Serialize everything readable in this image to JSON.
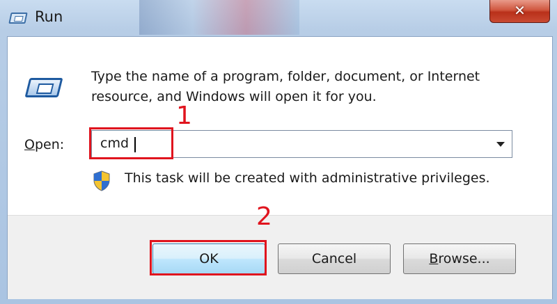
{
  "window": {
    "title": "Run",
    "close_label": "✕"
  },
  "dialog": {
    "description": "Type the name of a program, folder, document, or Internet resource, and Windows will open it for you.",
    "open_label_accel": "O",
    "open_label_rest": "pen:",
    "open_value": "cmd",
    "admin_notice": "This task will be created with administrative privileges."
  },
  "buttons": {
    "ok": "OK",
    "cancel": "Cancel",
    "browse_accel": "B",
    "browse_rest": "rowse..."
  },
  "annotations": {
    "step1": "1",
    "step2": "2",
    "color": "#e0141e"
  },
  "icons": [
    "run-icon",
    "shield-icon",
    "close-icon",
    "dropdown-arrow-icon"
  ]
}
